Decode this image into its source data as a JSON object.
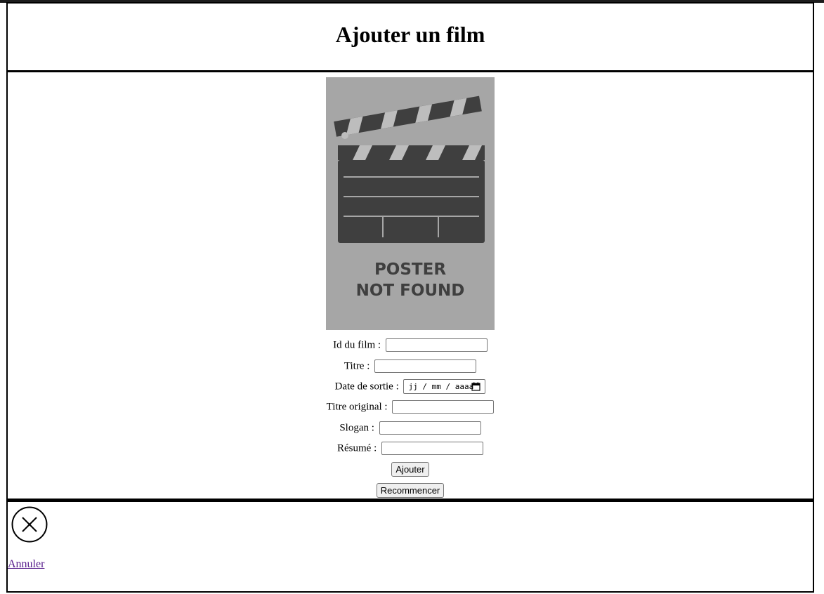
{
  "header": {
    "title": "Ajouter un film"
  },
  "poster": {
    "line1": "POSTER",
    "line2": "NOT FOUND",
    "background": "#a6a6a6",
    "foreground": "#3f3f3f"
  },
  "form": {
    "id_label": "Id du film :",
    "id_value": "",
    "title_label": "Titre :",
    "title_value": "",
    "date_label": "Date de sortie :",
    "date_placeholder": "jj / mm / aaaa",
    "original_title_label": "Titre original :",
    "original_title_value": "",
    "slogan_label": "Slogan :",
    "slogan_value": "",
    "summary_label": "Résumé :",
    "summary_value": "",
    "submit_label": "Ajouter",
    "reset_label": "Recommencer"
  },
  "footer": {
    "close_icon": "circle-x-icon",
    "cancel_link": "Annuler",
    "link_color": "#551a8b"
  }
}
